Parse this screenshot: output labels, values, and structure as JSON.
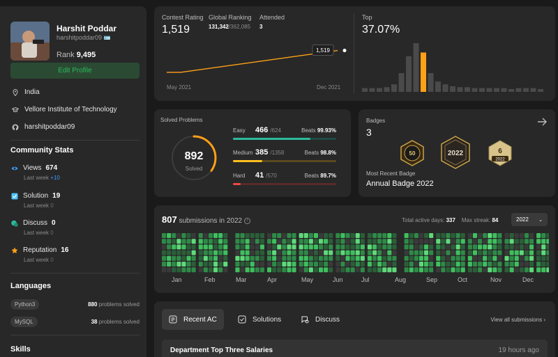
{
  "profile": {
    "name": "Harshit Poddar",
    "username": "harshitpoddar09",
    "rank_label": "Rank",
    "rank_value": "9,495",
    "edit_label": "Edit Profile",
    "location": "India",
    "school": "Vellore Institute of Technology",
    "github": "harshitpoddar09"
  },
  "community": {
    "title": "Community Stats",
    "items": [
      {
        "label": "Views",
        "value": "674",
        "sub": "Last week",
        "delta": "+10",
        "color": "#3b9cff"
      },
      {
        "label": "Solution",
        "value": "19",
        "sub": "Last week",
        "delta": "0",
        "color": "#4fc3f7"
      },
      {
        "label": "Discuss",
        "value": "0",
        "sub": "Last week",
        "delta": "0",
        "color": "#2cbb9c"
      },
      {
        "label": "Reputation",
        "value": "16",
        "sub": "Last week",
        "delta": "0",
        "color": "#ffa116"
      }
    ]
  },
  "languages": {
    "title": "Languages",
    "items": [
      {
        "name": "Python3",
        "count": "880",
        "suffix": "problems solved"
      },
      {
        "name": "MySQL",
        "count": "38",
        "suffix": "problems solved"
      }
    ]
  },
  "skills": {
    "title": "Skills"
  },
  "contest": {
    "rating_label": "Contest Rating",
    "rating_value": "1,519",
    "global_label": "Global Ranking",
    "global_value": "131,342",
    "global_total": "/362,085",
    "attended_label": "Attended",
    "attended_value": "3",
    "tooltip": "1,519",
    "date_start": "May 2021",
    "date_end": "Dec 2021",
    "top_label": "Top",
    "top_value": "37.07%",
    "rating_history": [
      1475,
      1475,
      1519
    ],
    "histogram": [
      4,
      4,
      4,
      5,
      8,
      20,
      38,
      52,
      42,
      20,
      11,
      8,
      6,
      5,
      5,
      4,
      4,
      4,
      4,
      4,
      3,
      4,
      4,
      4,
      3
    ],
    "histogram_highlight": 8
  },
  "solved": {
    "title": "Solved Problems",
    "total": "892",
    "total_label": "Solved",
    "total_fraction": 0.35,
    "difficulties": [
      {
        "label": "Easy",
        "solved": "466",
        "total": "/624",
        "beats_label": "Beats",
        "beats": "99.93%",
        "frac": 0.747,
        "color": "#2cbb9c",
        "track": "#1f4a44"
      },
      {
        "label": "Medium",
        "solved": "385",
        "total": "/1358",
        "beats_label": "Beats",
        "beats": "98.8%",
        "frac": 0.283,
        "color": "#ffc01e",
        "track": "#5a4a1f"
      },
      {
        "label": "Hard",
        "solved": "41",
        "total": "/570",
        "beats_label": "Beats",
        "beats": "89.7%",
        "frac": 0.072,
        "color": "#ef4743",
        "track": "#5a2a2a"
      }
    ]
  },
  "badges": {
    "title": "Badges",
    "count": "3",
    "recent_label": "Most Recent Badge",
    "recent_name": "Annual Badge 2022",
    "items": [
      {
        "text": "50"
      },
      {
        "text": "2022"
      },
      {
        "text": "6",
        "sub": "2022"
      }
    ]
  },
  "submissions": {
    "count": "807",
    "suffix": "submissions in 2022",
    "active_label": "Total active days:",
    "active_value": "337",
    "streak_label": "Max streak:",
    "streak_value": "84",
    "year": "2022",
    "months": [
      "Jan",
      "Feb",
      "Mar",
      "Apr",
      "May",
      "Jun",
      "Jul",
      "Aug",
      "Sep",
      "Oct",
      "Nov",
      "Dec"
    ]
  },
  "recent": {
    "tabs": [
      {
        "label": "Recent AC"
      },
      {
        "label": "Solutions"
      },
      {
        "label": "Discuss"
      }
    ],
    "view_all": "View all submissions",
    "rows": [
      {
        "title": "Department Top Three Salaries",
        "time": "19 hours ago"
      }
    ]
  }
}
